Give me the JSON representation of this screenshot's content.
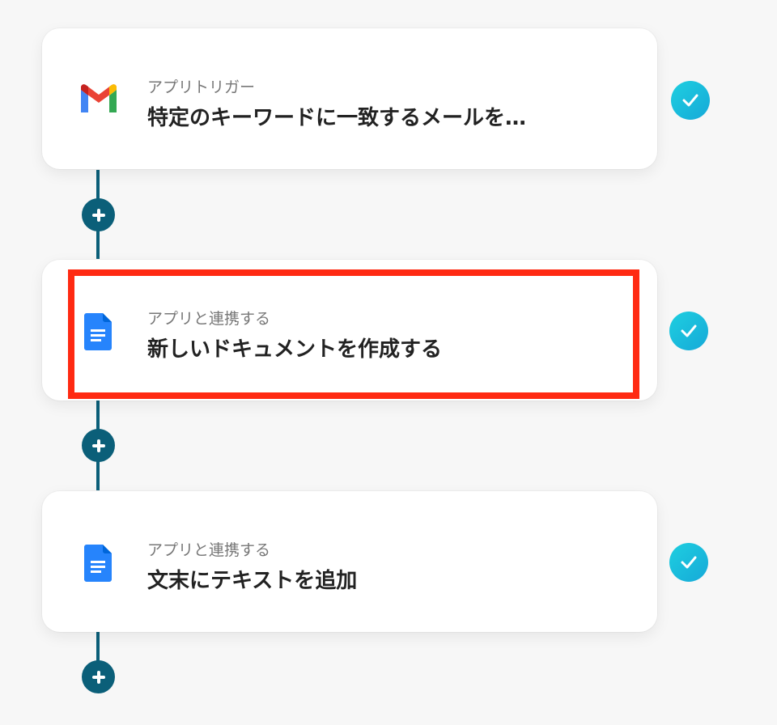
{
  "flow": {
    "steps": [
      {
        "label": "アプリトリガー",
        "title": "特定のキーワードに一致するメールを…",
        "app_icon": "gmail-icon",
        "status_icon": "check-icon"
      },
      {
        "label": "アプリと連携する",
        "title": "新しいドキュメントを作成する",
        "app_icon": "google-docs-icon",
        "status_icon": "check-icon",
        "highlighted": true
      },
      {
        "label": "アプリと連携する",
        "title": "文末にテキストを追加",
        "app_icon": "google-docs-icon",
        "status_icon": "check-icon"
      }
    ],
    "add_step_icon": "plus-icon"
  },
  "colors": {
    "background": "#f7f7f7",
    "connector": "#0b5f79",
    "check_gradient_start": "#1ecfe0",
    "check_gradient_end": "#16a9d8",
    "highlight_border": "#ff2a12",
    "docs_blue": "#2684fc",
    "gmail_red": "#ea4335",
    "gmail_blue": "#4285f4",
    "gmail_green": "#34a853",
    "gmail_yellow": "#fbbc04"
  }
}
